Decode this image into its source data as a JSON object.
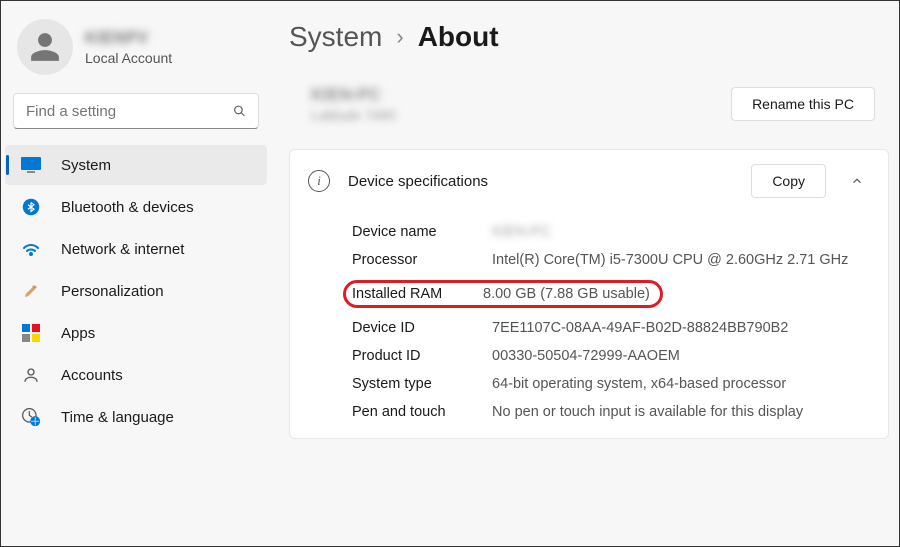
{
  "user": {
    "name": "KIENPV",
    "account_type": "Local Account",
    "search_placeholder": "Find a setting"
  },
  "sidebar": {
    "items": [
      {
        "label": "System",
        "active": true
      },
      {
        "label": "Bluetooth & devices"
      },
      {
        "label": "Network & internet"
      },
      {
        "label": "Personalization"
      },
      {
        "label": "Apps"
      },
      {
        "label": "Accounts"
      },
      {
        "label": "Time & language"
      }
    ]
  },
  "breadcrumb": {
    "parent": "System",
    "current": "About"
  },
  "pc": {
    "name_masked": "KIEN-PC",
    "model_masked": "Latitude 7480",
    "rename_btn": "Rename this PC"
  },
  "specs": {
    "header": "Device specifications",
    "copy_btn": "Copy",
    "rows": [
      {
        "label": "Device name",
        "value": "KIEN-PC",
        "blur": true
      },
      {
        "label": "Processor",
        "value": "Intel(R) Core(TM) i5-7300U CPU @ 2.60GHz 2.71 GHz"
      },
      {
        "label": "Installed RAM",
        "value": "8.00 GB (7.88 GB usable)",
        "highlight": true
      },
      {
        "label": "Device ID",
        "value": "7EE1107C-08AA-49AF-B02D-88824BB790B2"
      },
      {
        "label": "Product ID",
        "value": "00330-50504-72999-AAOEM"
      },
      {
        "label": "System type",
        "value": "64-bit operating system, x64-based processor"
      },
      {
        "label": "Pen and touch",
        "value": "No pen or touch input is available for this display"
      }
    ]
  }
}
